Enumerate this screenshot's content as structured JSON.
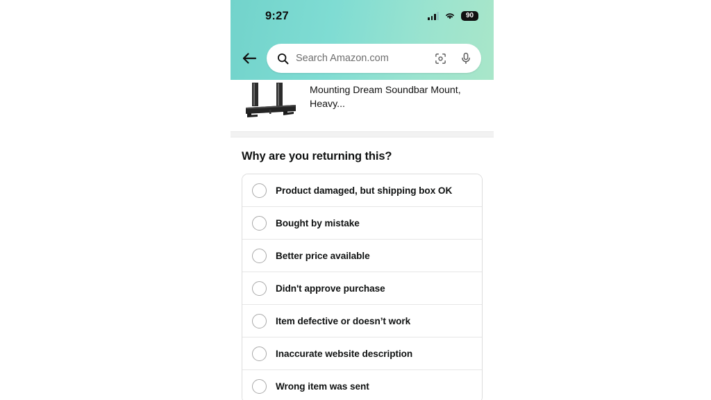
{
  "status_bar": {
    "time": "9:27",
    "battery_level": "90",
    "signal_icon": "cellular-signal-icon",
    "wifi_icon": "wifi-icon",
    "battery_icon": "battery-icon"
  },
  "header": {
    "back_icon": "back-arrow-icon",
    "gradient_start": "#72d3cb",
    "gradient_end": "#a9e6c9"
  },
  "search": {
    "placeholder": "Search Amazon.com",
    "search_icon": "search-icon",
    "camera_icon": "camera-scan-icon",
    "mic_icon": "microphone-icon"
  },
  "product": {
    "title": "Mounting Dream Soundbar Mount, Heavy...",
    "image_alt": "soundbar-mount-bracket"
  },
  "question": {
    "title": "Why are you returning this?"
  },
  "reasons": [
    {
      "label": "Product damaged, but shipping box OK",
      "selected": false
    },
    {
      "label": "Bought by mistake",
      "selected": false
    },
    {
      "label": "Better price available",
      "selected": false
    },
    {
      "label": "Didn't approve purchase",
      "selected": false
    },
    {
      "label": "Item defective or doesn’t work",
      "selected": false
    },
    {
      "label": "Inaccurate website description",
      "selected": false
    },
    {
      "label": "Wrong item was sent",
      "selected": false
    }
  ]
}
